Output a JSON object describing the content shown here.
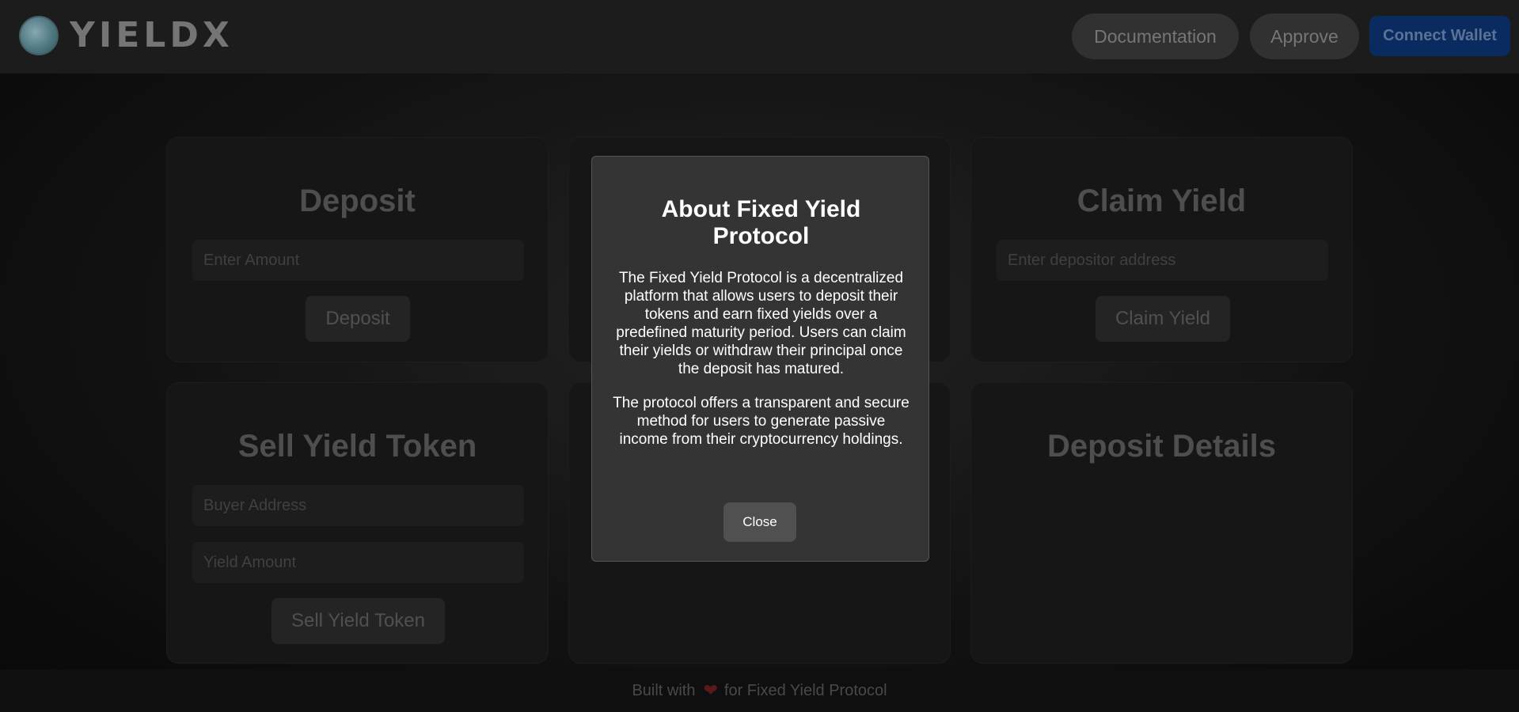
{
  "header": {
    "brand": "YIELDX",
    "nav": {
      "documentation": "Documentation",
      "approve": "Approve",
      "connect_wallet": "Connect Wallet"
    }
  },
  "cards": {
    "deposit": {
      "title": "Deposit",
      "input_placeholder": "Enter Amount",
      "button": "Deposit"
    },
    "claim_yield": {
      "title": "Claim Yield",
      "input_placeholder": "Enter depositor address",
      "button": "Claim Yield"
    },
    "sell_yield_token": {
      "title": "Sell Yield Token",
      "buyer_placeholder": "Buyer Address",
      "amount_placeholder": "Yield Amount",
      "button": "Sell Yield Token"
    },
    "deposit_details": {
      "title": "Deposit Details"
    }
  },
  "footer": {
    "prefix": "Built with",
    "heart": "❤",
    "suffix": "for Fixed Yield Protocol"
  },
  "modal": {
    "title": "About Fixed Yield Protocol",
    "paragraph1": "The Fixed Yield Protocol is a decentralized platform that allows users to deposit their tokens and earn fixed yields over a predefined maturity period. Users can claim their yields or withdraw their principal once the deposit has matured.",
    "paragraph2": "The protocol offers a transparent and secure method for users to generate passive income from their cryptocurrency holdings.",
    "close": "Close"
  },
  "colors": {
    "background": "#0b0b0b",
    "card": "#1b1b1b",
    "modal": "#343434",
    "connect_wallet": "#0c3371"
  }
}
